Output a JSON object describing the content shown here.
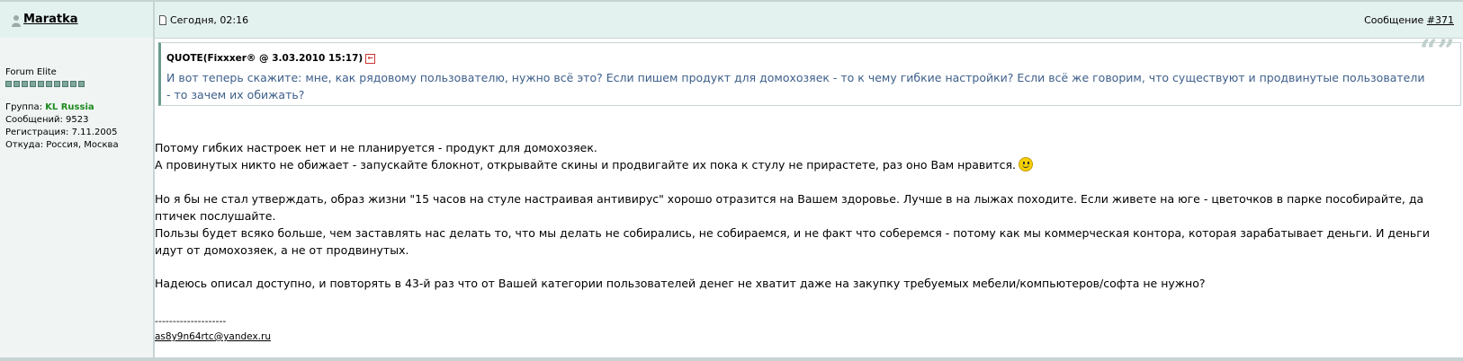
{
  "post": {
    "author": "Maratka",
    "date": "Сегодня, 02:16",
    "message_label": "Сообщение",
    "message_number": "#371"
  },
  "sidebar": {
    "rank": "Forum Elite",
    "pip_count": 10,
    "group_label": "Группа:",
    "group_value": "KL Russia",
    "posts": "Сообщений: 9523",
    "registered": "Регистрация: 7.11.2005",
    "location": "Откуда: Россия, Москва"
  },
  "quote": {
    "title": "QUOTE(Fixxxer® @ 3.03.2010 15:17)",
    "text": "И вот теперь скажите: мне, как рядовому пользователю, нужно всё это? Если пишем продукт для домохозяек - то к чему гибкие настройки? Если всё же говорим, что существуют и продвинутые пользователи - то зачем их обижать?"
  },
  "body": {
    "p1": "Потому гибких настроек нет и не планируется - продукт для домохозяек.",
    "p2": "А провинутых никто не обижает - запускайте блокнот, открывайте скины и продвигайте их пока к стулу не прирастете, раз оно Вам нравится.",
    "p3": "Но я бы не стал утверждать, образ жизни \"15 часов на стуле настраивая антивирус\" хорошо отразится на Вашем здоровье. Лучше в на лыжах походите. Если живете на юге - цветочков в парке пособирайте, да птичек послушайте.",
    "p4": "Пользы будет всяко больше, чем заставлять нас делать то, что мы делать не собирались, не собираемся, и не факт что соберемся - потому как мы коммерческая контора, которая зарабатывает деньги. И деньги идут от домохозяек, а не от продвинутых.",
    "p5": "Надеюсь описал доступно, и повторять в 43-й раз что от Вашей категории пользователей денег не хватит даже на закупку требуемых мебели/компьютеров/софта не нужно?"
  },
  "signature": {
    "dashes": "--------------------",
    "email": "as8y9n64rtc@yandex.ru"
  },
  "colors": {
    "header_bg": "#e4f2ef",
    "sidebar_bg": "#f0f5f4",
    "border": "#c8d4d4",
    "quote_text": "#3d5f8a",
    "group": "#1e8a1e"
  }
}
